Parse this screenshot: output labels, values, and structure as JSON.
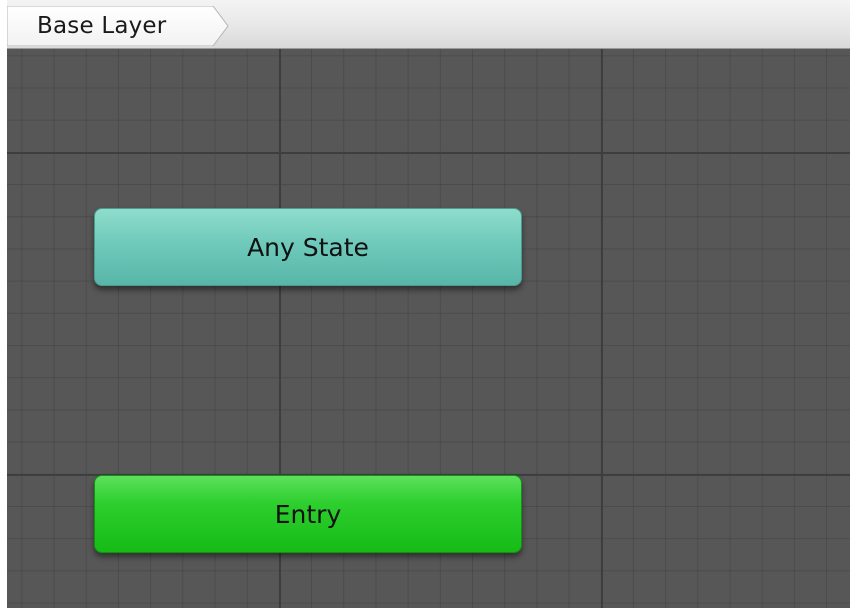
{
  "header": {
    "breadcrumb_label": "Base Layer"
  },
  "graph": {
    "states": [
      {
        "label": "Any State",
        "color": "#6fcabb"
      },
      {
        "label": "Entry",
        "color": "#2ecf2e"
      }
    ]
  },
  "colors": {
    "canvas_background": "#575757",
    "grid_major": "#3e3e3e",
    "header_background": "#e6e6e6"
  }
}
